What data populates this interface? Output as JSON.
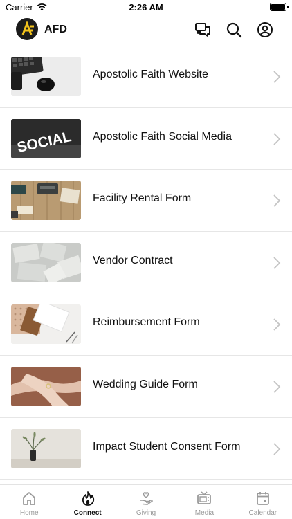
{
  "status_bar": {
    "carrier": "Carrier",
    "time": "2:26 AM"
  },
  "header": {
    "app_title": "AFD"
  },
  "items": [
    {
      "label": "Apostolic Faith Website"
    },
    {
      "label": "Apostolic Faith Social Media",
      "thumb_text": "SOCIAL"
    },
    {
      "label": "Facility Rental Form"
    },
    {
      "label": "Vendor Contract"
    },
    {
      "label": "Reimbursement Form"
    },
    {
      "label": "Wedding Guide Form"
    },
    {
      "label": "Impact Student Consent Form"
    }
  ],
  "tabs": [
    {
      "label": "Home",
      "icon": "home-icon",
      "active": false
    },
    {
      "label": "Connect",
      "icon": "flame-icon",
      "active": true
    },
    {
      "label": "Giving",
      "icon": "hand-heart-icon",
      "active": false
    },
    {
      "label": "Media",
      "icon": "tv-icon",
      "active": false
    },
    {
      "label": "Calendar",
      "icon": "calendar-icon",
      "active": false
    }
  ],
  "colors": {
    "active_tab": "#111111",
    "inactive_tab": "#9a9a9a",
    "logo_accent": "#f2c21b"
  }
}
